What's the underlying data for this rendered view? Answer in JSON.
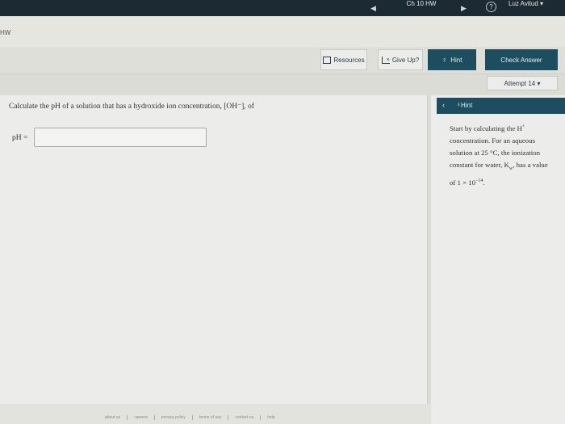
{
  "topbar": {
    "title": "Ch 10 HW",
    "user": "Luz Avitud",
    "nav_prev": "◀",
    "nav_next": "▶",
    "help": "?",
    "user_caret": "▾"
  },
  "breadcrumb": "HW",
  "toolbar": {
    "resources_label": "Resources",
    "giveup_label": "Give Up?",
    "hint_label": "Hint",
    "check_label": "Check Answer"
  },
  "attempt": {
    "label": "Attempt 14",
    "caret": "▾"
  },
  "question": {
    "text": "Calculate the pH of a solution that has a hydroxide ion concentration, [OH⁻], of",
    "answer_label": "pH =",
    "answer_value": ""
  },
  "hint_panel": {
    "back": "‹",
    "title": "Hint",
    "text_1": "Start by calculating the H",
    "text_1_sup": "+",
    "text_2": "concentration. For an aqueous",
    "text_3": "solution at 25 °C, the ionization",
    "text_4_a": "constant for water, K",
    "text_4_sub": "w",
    "text_4_b": ", has a value",
    "text_5_a": "of 1 × 10",
    "text_5_sup": "−14",
    "text_5_b": "."
  },
  "footer": {
    "links": [
      "about us",
      "careers",
      "privacy policy",
      "terms of use",
      "contact us",
      "help"
    ]
  }
}
